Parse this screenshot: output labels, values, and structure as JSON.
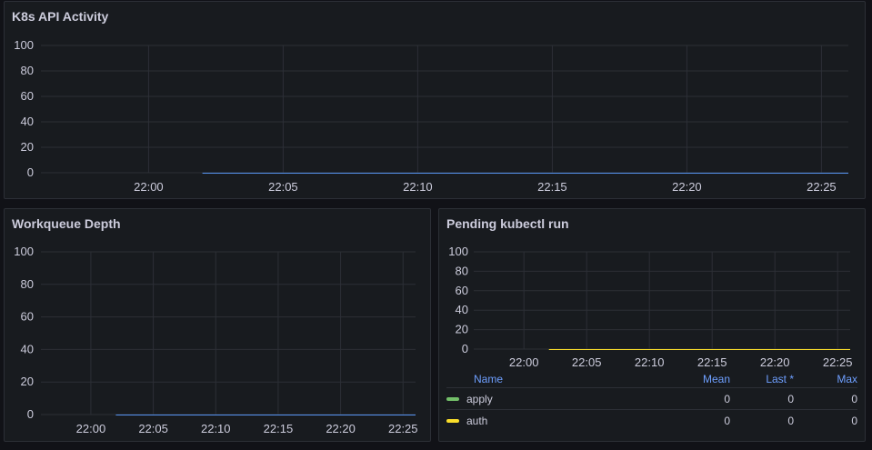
{
  "panels": {
    "api": {
      "title": "K8s API Activity",
      "color": "#5794f2"
    },
    "workqueue": {
      "title": "Workqueue Depth",
      "color": "#5794f2"
    },
    "pending": {
      "title": "Pending kubectl run",
      "legend": {
        "headers": {
          "name": "Name",
          "mean": "Mean",
          "last": "Last *",
          "max": "Max"
        },
        "rows": [
          {
            "name": "apply",
            "mean": "0",
            "last": "0",
            "max": "0",
            "color": "#73bf69"
          },
          {
            "name": "auth",
            "mean": "0",
            "last": "0",
            "max": "0",
            "color": "#fade2a"
          }
        ]
      }
    }
  },
  "chart_data": [
    {
      "type": "line",
      "title": "K8s API Activity",
      "x_ticks": [
        "22:00",
        "22:05",
        "22:10",
        "22:15",
        "22:20",
        "22:25"
      ],
      "y_ticks": [
        "0",
        "20",
        "40",
        "60",
        "80",
        "100"
      ],
      "ylim": [
        0,
        100
      ],
      "grid": true,
      "series": [
        {
          "x": [
            "22:02",
            "22:26"
          ],
          "values": [
            0,
            0
          ],
          "color": "#5794f2"
        }
      ]
    },
    {
      "type": "line",
      "title": "Workqueue Depth",
      "x_ticks": [
        "22:00",
        "22:05",
        "22:10",
        "22:15",
        "22:20",
        "22:25"
      ],
      "y_ticks": [
        "0",
        "20",
        "40",
        "60",
        "80",
        "100"
      ],
      "ylim": [
        0,
        100
      ],
      "grid": true,
      "series": [
        {
          "x": [
            "22:02",
            "22:26"
          ],
          "values": [
            0,
            0
          ],
          "color": "#5794f2"
        }
      ]
    },
    {
      "type": "line",
      "title": "Pending kubectl run",
      "x_ticks": [
        "22:00",
        "22:05",
        "22:10",
        "22:15",
        "22:20",
        "22:25"
      ],
      "y_ticks": [
        "0",
        "20",
        "40",
        "60",
        "80",
        "100"
      ],
      "ylim": [
        0,
        100
      ],
      "grid": true,
      "series": [
        {
          "name": "apply",
          "x": [
            "22:02",
            "22:26"
          ],
          "values": [
            0,
            0
          ],
          "color": "#73bf69"
        },
        {
          "name": "auth",
          "x": [
            "22:02",
            "22:26"
          ],
          "values": [
            0,
            0
          ],
          "color": "#fade2a"
        }
      ]
    }
  ]
}
